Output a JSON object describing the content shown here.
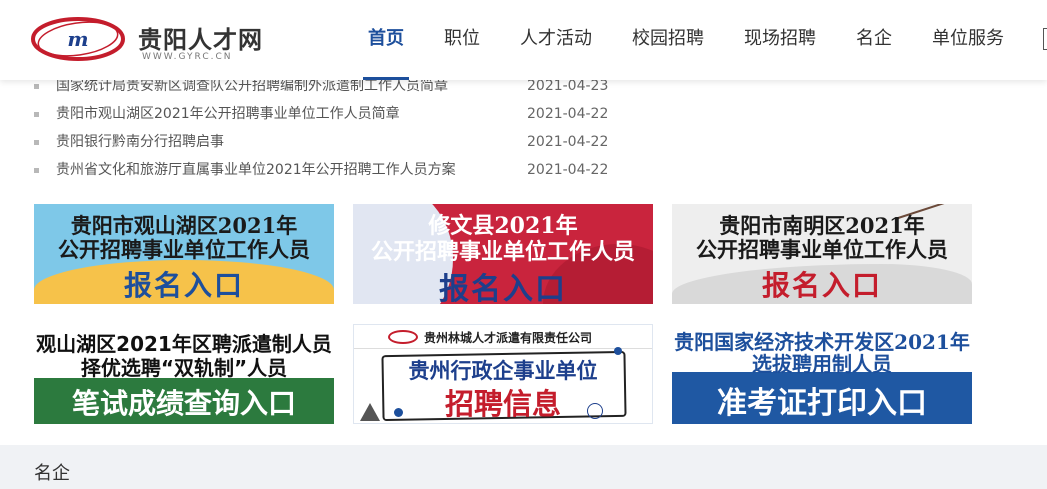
{
  "header": {
    "logo_title": "贵阳人才网",
    "logo_sub": "WWW.GYRC.CN",
    "nav": [
      {
        "label": "首页",
        "active": true
      },
      {
        "label": "职位"
      },
      {
        "label": "人才活动"
      },
      {
        "label": "校园招聘"
      },
      {
        "label": "现场招聘"
      },
      {
        "label": "名企"
      },
      {
        "label": "单位服务"
      }
    ]
  },
  "news": [
    {
      "title": "国家统计局贵安新区调查队公开招聘编制外派遣制工作人员简章",
      "date": "2021-04-23"
    },
    {
      "title": "贵阳市观山湖区2021年公开招聘事业单位工作人员简章",
      "date": "2021-04-22"
    },
    {
      "title": "贵阳银行黔南分行招聘启事",
      "date": "2021-04-22"
    },
    {
      "title": "贵州省文化和旅游厅直属事业单位2021年公开招聘工作人员方案",
      "date": "2021-04-22"
    }
  ],
  "banners": {
    "b1": {
      "line1": "贵阳市观山湖区2021年",
      "line2": "公开招聘事业单位工作人员",
      "line3": "报名入口"
    },
    "b2": {
      "line1": "修文县2021年",
      "line2": "公开招聘事业单位工作人员",
      "line3": "报名入口"
    },
    "b3": {
      "line1": "贵阳市南明区2021年",
      "line2": "公开招聘事业单位工作人员",
      "line3": "报名入口"
    },
    "b4": {
      "line1": "观山湖区2021年区聘派遣制人员",
      "line2": "择优选聘“双轨制”人员",
      "line3": "笔试成绩查询入口"
    },
    "b5": {
      "company": "贵州林城人才派遣有限责任公司",
      "line1": "贵州行政企事业单位",
      "line3": "招聘信息"
    },
    "b6": {
      "line1": "贵阳国家经济技术开发区2021年",
      "line2": "选拔聘用制人员",
      "line3": "准考证打印入口"
    }
  },
  "section": {
    "title": "名企"
  },
  "colors": {
    "brand_blue": "#1d4f9c",
    "brand_red": "#c41d2c",
    "section_bg": "#f0f2f5"
  }
}
